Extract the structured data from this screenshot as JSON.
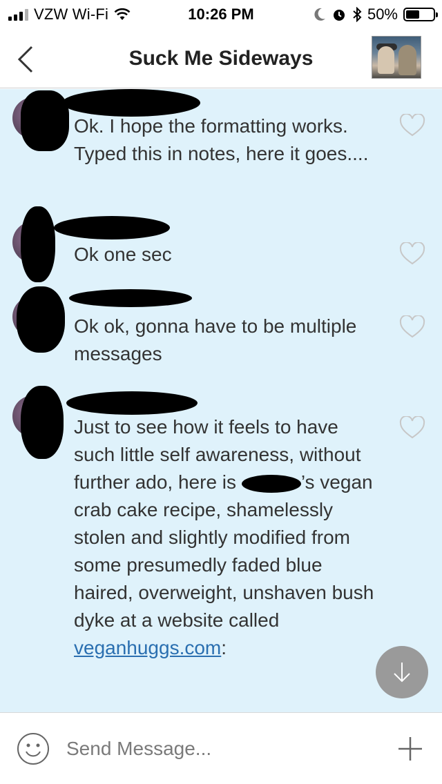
{
  "status_bar": {
    "carrier": "VZW Wi-Fi",
    "time": "10:26 PM",
    "battery_percent": "50%",
    "battery_level": 0.5,
    "icons": [
      "signal-icon",
      "wifi-icon",
      "moon-icon",
      "alarm-icon",
      "bluetooth-icon",
      "battery-icon"
    ]
  },
  "nav": {
    "title": "Suck Me Sideways",
    "back_icon": "chevron-left-icon"
  },
  "messages": [
    {
      "text": "Ok. I hope the formatting works. Typed this in notes, here it goes....",
      "liked": false
    },
    {
      "text": "Ok one sec",
      "liked": false
    },
    {
      "text": "Ok ok, gonna have to be multiple messages",
      "liked": false
    },
    {
      "text_before_redaction": "Just to see how it feels to have such little self awareness, without further ado, here is ",
      "text_after_redaction": "’s vegan crab cake recipe, shamelessly stolen and slightly modified from some presumedly faded blue haired, overweight, unshaven bush dyke at a website called ",
      "link": "veganhuggs.com",
      "text_end": ":",
      "liked": false
    }
  ],
  "composer": {
    "placeholder": "Send Message...",
    "emoji_icon": "smiley-icon",
    "add_icon": "plus-icon"
  },
  "colors": {
    "chat_background": "#dff2fb",
    "link": "#2a6fb0",
    "fab": "#9a9a9a"
  }
}
